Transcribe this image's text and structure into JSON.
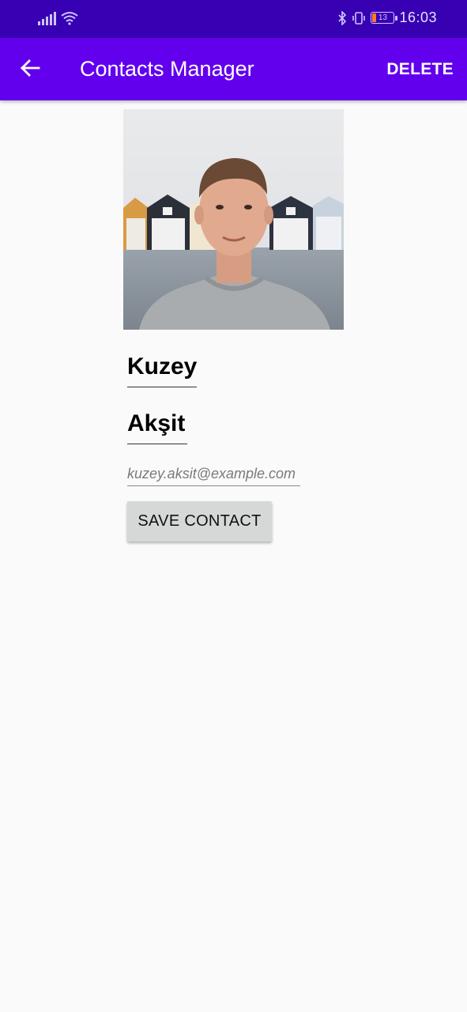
{
  "status_bar": {
    "time": "16:03",
    "battery_level": "13",
    "icons": [
      "signal-icon",
      "wifi-icon",
      "bluetooth-icon",
      "vibrate-icon",
      "battery-icon"
    ]
  },
  "app_bar": {
    "title": "Contacts Manager",
    "back_icon": "arrow-back-icon",
    "action_label": "DELETE"
  },
  "contact": {
    "photo_description": "contact-photo",
    "first_name": "Kuzey",
    "last_name": "Akşit",
    "email": "kuzey.aksit@example.com"
  },
  "actions": {
    "save_label": "SAVE CONTACT"
  },
  "colors": {
    "status_bar": "#3700b3",
    "app_bar": "#6200ee",
    "background": "#fafafa",
    "button": "#d6d7d7"
  }
}
